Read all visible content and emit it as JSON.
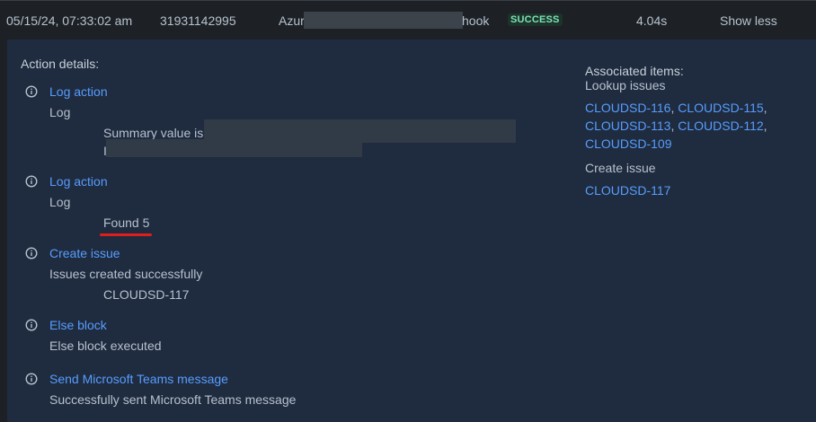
{
  "row": {
    "timestamp": "05/15/24, 07:33:02 am",
    "id": "31931142995",
    "name_prefix": "Azur",
    "name_suffix": "hook",
    "status": "SUCCESS",
    "duration": "4.04s",
    "toggle_label": "Show less"
  },
  "details": {
    "heading": "Action details:",
    "actions": [
      {
        "title": "Log action",
        "type": "Log",
        "value": "Summary value is:"
      },
      {
        "title": "Log action",
        "type": "Log",
        "value": "Found 5"
      },
      {
        "title": "Create issue",
        "type": "Issues created successfully",
        "value": "CLOUDSD-117"
      },
      {
        "title": "Else block",
        "type": "Else block executed"
      },
      {
        "title": "Send Microsoft Teams message",
        "type": "Successfully sent Microsoft Teams message"
      }
    ]
  },
  "associated": {
    "heading": "Associated items:",
    "lookup_label": "Lookup issues",
    "lookup_issues": [
      "CLOUDSD-116",
      "CLOUDSD-115",
      "CLOUDSD-113",
      "CLOUDSD-112",
      "CLOUDSD-109"
    ],
    "create_label": "Create issue",
    "created_issues": [
      "CLOUDSD-117"
    ]
  },
  "colors": {
    "accent": "#579dff",
    "success_bg": "#1c3329",
    "success_text": "#7ee2b8",
    "highlight": "#e01e1e"
  },
  "icons": {
    "action_icon": "info-icon"
  }
}
